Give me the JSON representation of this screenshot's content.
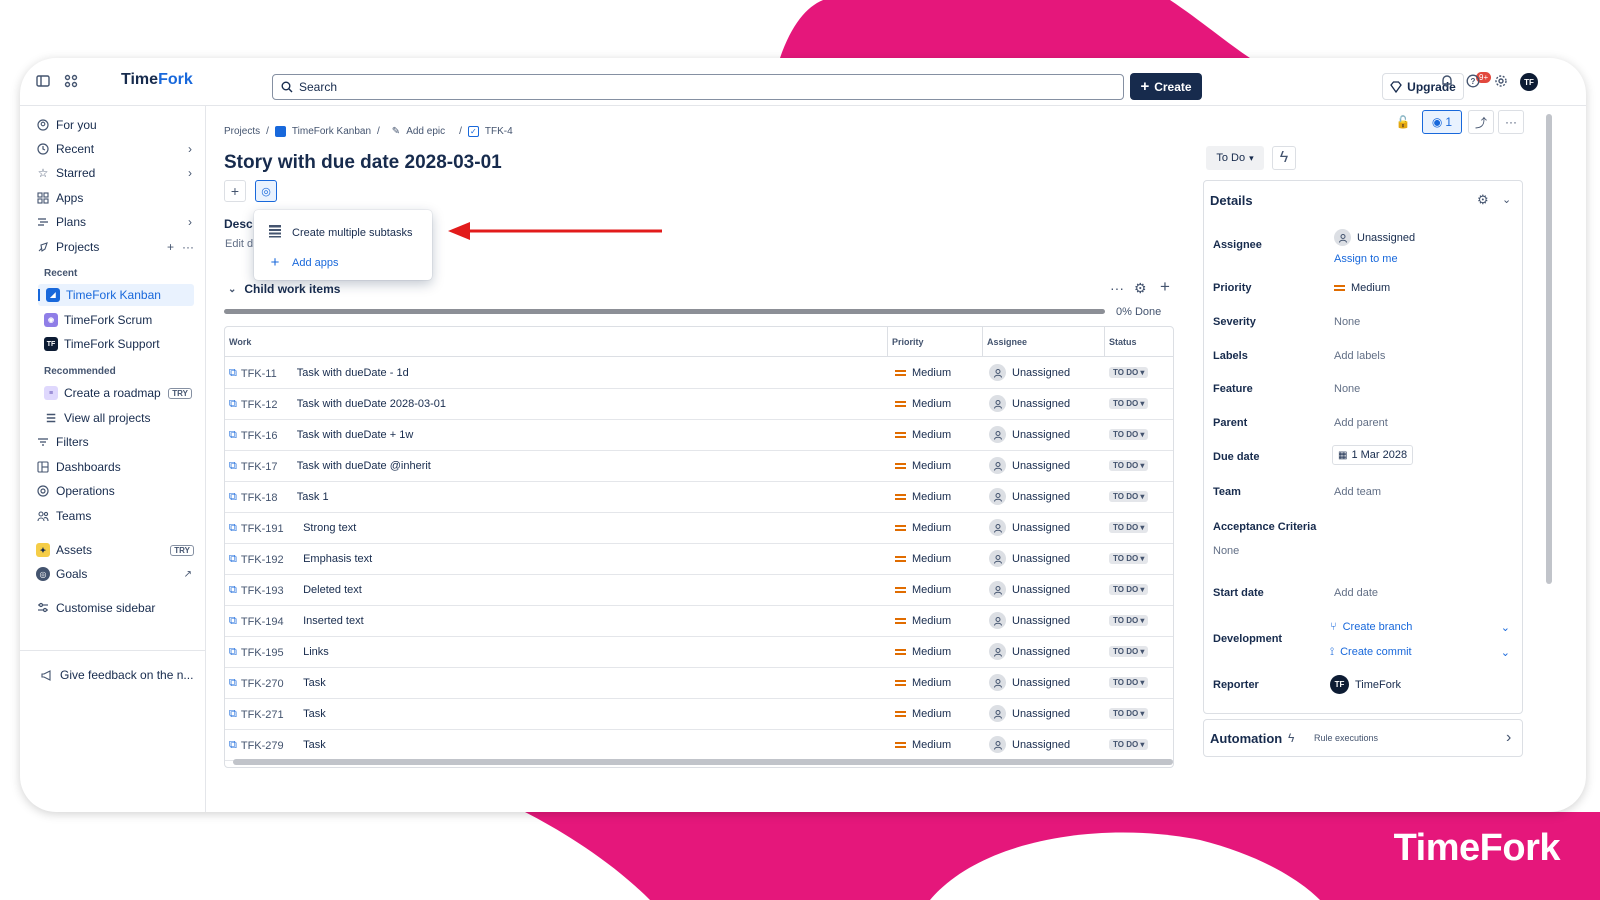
{
  "colors": {
    "accent": "#1868db",
    "brand_pink": "#e5177b",
    "dark": "#172b4d",
    "priority": "#e06c00"
  },
  "brand_corner": "TimeFork",
  "topbar": {
    "logo_a": "Time",
    "logo_b": "Fork",
    "search_placeholder": "Search",
    "create_label": "Create",
    "upgrade_label": "Upgrade",
    "notif_badge": "9+",
    "avatar": "TF"
  },
  "sidebar": {
    "for_you": "For you",
    "recent": "Recent",
    "starred": "Starred",
    "apps": "Apps",
    "plans": "Plans",
    "projects": "Projects",
    "recent_heading": "Recent",
    "recent_projects": [
      "TimeFork Kanban",
      "TimeFork Scrum",
      "TimeFork Support"
    ],
    "recommended_heading": "Recommended",
    "create_roadmap": "Create a roadmap",
    "try": "TRY",
    "view_all": "View all projects",
    "filters": "Filters",
    "dashboards": "Dashboards",
    "operations": "Operations",
    "teams": "Teams",
    "assets": "Assets",
    "goals": "Goals",
    "customise": "Customise sidebar",
    "feedback": "Give feedback on the n..."
  },
  "breadcrumb": {
    "projects": "Projects",
    "project": "TimeFork Kanban",
    "epic": "Add epic",
    "issue": "TFK-4"
  },
  "issue": {
    "title": "Story with due date 2028-03-01",
    "description_label": "Desc",
    "description_edit": "Edit d"
  },
  "popup": {
    "item1": "Create multiple subtasks",
    "item2": "Add apps"
  },
  "child": {
    "title": "Child work items",
    "progress": 0,
    "progress_text": "0% Done",
    "headers": [
      "Work",
      "Priority",
      "Assignee",
      "Status"
    ],
    "rows": [
      {
        "key": "TFK-11",
        "summary": "Task with dueDate - 1d"
      },
      {
        "key": "TFK-12",
        "summary": "Task with dueDate 2028-03-01"
      },
      {
        "key": "TFK-16",
        "summary": "Task with dueDate + 1w"
      },
      {
        "key": "TFK-17",
        "summary": "Task with dueDate @inherit"
      },
      {
        "key": "TFK-18",
        "summary": "Task 1"
      },
      {
        "key": "TFK-191",
        "summary": "Strong text"
      },
      {
        "key": "TFK-192",
        "summary": "Emphasis text"
      },
      {
        "key": "TFK-193",
        "summary": "Deleted text"
      },
      {
        "key": "TFK-194",
        "summary": "Inserted text"
      },
      {
        "key": "TFK-195",
        "summary": "Links"
      },
      {
        "key": "TFK-270",
        "summary": "Task"
      },
      {
        "key": "TFK-271",
        "summary": "Task"
      },
      {
        "key": "TFK-279",
        "summary": "Task"
      }
    ],
    "priority": "Medium",
    "assignee": "Unassigned",
    "status": "TO DO"
  },
  "right": {
    "status": "To Do",
    "watchers": "1",
    "details_title": "Details",
    "assignee_label": "Assignee",
    "assignee": "Unassigned",
    "assign_to_me": "Assign to me",
    "priority_label": "Priority",
    "priority": "Medium",
    "severity_label": "Severity",
    "severity": "None",
    "labels_label": "Labels",
    "labels": "Add labels",
    "feature_label": "Feature",
    "feature": "None",
    "parent_label": "Parent",
    "parent": "Add parent",
    "due_label": "Due date",
    "due": "1 Mar 2028",
    "team_label": "Team",
    "team": "Add team",
    "ac_label": "Acceptance Criteria",
    "ac": "None",
    "start_label": "Start date",
    "start": "Add date",
    "dev_label": "Development",
    "create_branch": "Create branch",
    "create_commit": "Create commit",
    "reporter_label": "Reporter",
    "reporter": "TimeFork",
    "automation": "Automation",
    "rule_exec": "Rule executions"
  }
}
